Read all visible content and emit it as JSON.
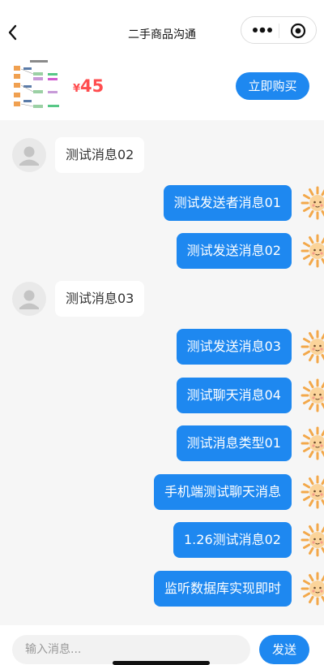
{
  "nav": {
    "title": "二手商品沟通"
  },
  "product": {
    "price_symbol": "¥",
    "price": "45",
    "buy_label": "立即购买"
  },
  "messages": [
    {
      "side": "left",
      "text": "测试消息02"
    },
    {
      "side": "right",
      "text": "测试发送者消息01"
    },
    {
      "side": "right",
      "text": "测试发送消息02"
    },
    {
      "side": "left",
      "text": "测试消息03"
    },
    {
      "side": "right",
      "text": "测试发送消息03"
    },
    {
      "side": "right",
      "text": "测试聊天消息04"
    },
    {
      "side": "right",
      "text": "测试消息类型01"
    },
    {
      "side": "right",
      "text": "手机端测试聊天消息"
    },
    {
      "side": "right",
      "text": "1.26测试消息02"
    },
    {
      "side": "right",
      "text": "监听数据库实现即时"
    }
  ],
  "input": {
    "placeholder": "输入消息...",
    "value": "",
    "send_label": "发送"
  },
  "colors": {
    "accent": "#1e88f0",
    "price": "#ff4d4f",
    "background": "#f6f6f6"
  }
}
